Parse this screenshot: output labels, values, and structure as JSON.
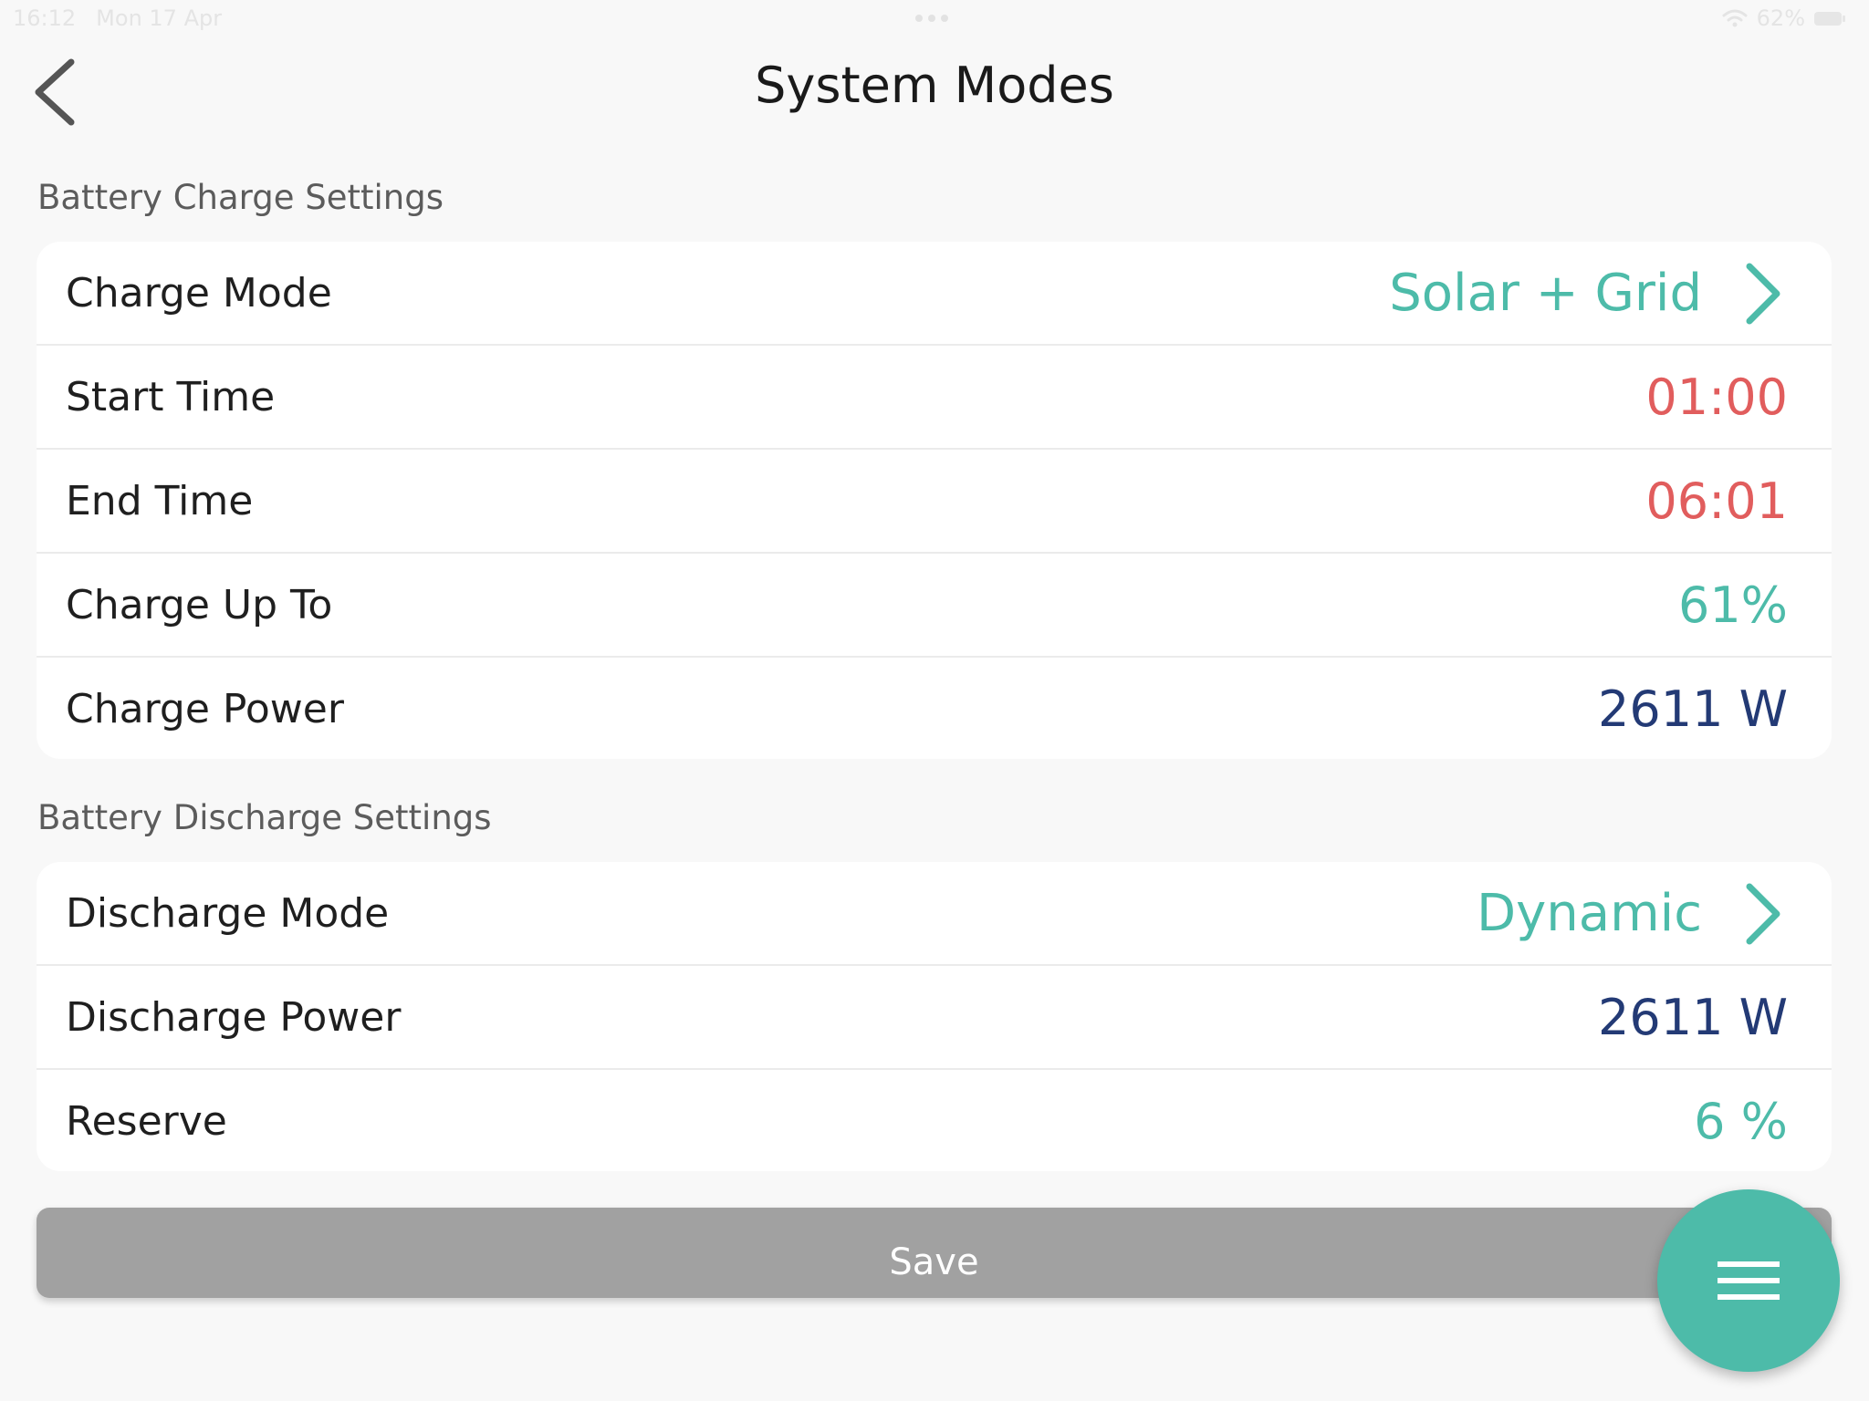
{
  "status_bar": {
    "time": "16:12",
    "date": "Mon 17 Apr",
    "battery_percent": "62%"
  },
  "header": {
    "title": "System Modes"
  },
  "charge_section": {
    "title": "Battery Charge Settings",
    "rows": [
      {
        "label": "Charge Mode",
        "value": "Solar + Grid"
      },
      {
        "label": "Start Time",
        "value": "01:00"
      },
      {
        "label": "End Time",
        "value": "06:01"
      },
      {
        "label": "Charge Up To",
        "value": "61%"
      },
      {
        "label": "Charge Power",
        "value": "2611 W"
      }
    ]
  },
  "discharge_section": {
    "title": "Battery Discharge Settings",
    "rows": [
      {
        "label": "Discharge Mode",
        "value": "Dynamic"
      },
      {
        "label": "Discharge Power",
        "value": "2611 W"
      },
      {
        "label": "Reserve",
        "value": "6 %"
      }
    ]
  },
  "actions": {
    "save_label": "Save"
  },
  "colors": {
    "accent": "#4dbba9",
    "time_value": "#e15d5d",
    "power_value": "#233a75",
    "save_disabled": "#a1a1a1"
  },
  "icons": {
    "back": "chevron-left-icon",
    "row_nav": "chevron-right-icon",
    "menu": "hamburger-menu-icon",
    "wifi": "wifi-icon",
    "battery": "battery-icon"
  }
}
